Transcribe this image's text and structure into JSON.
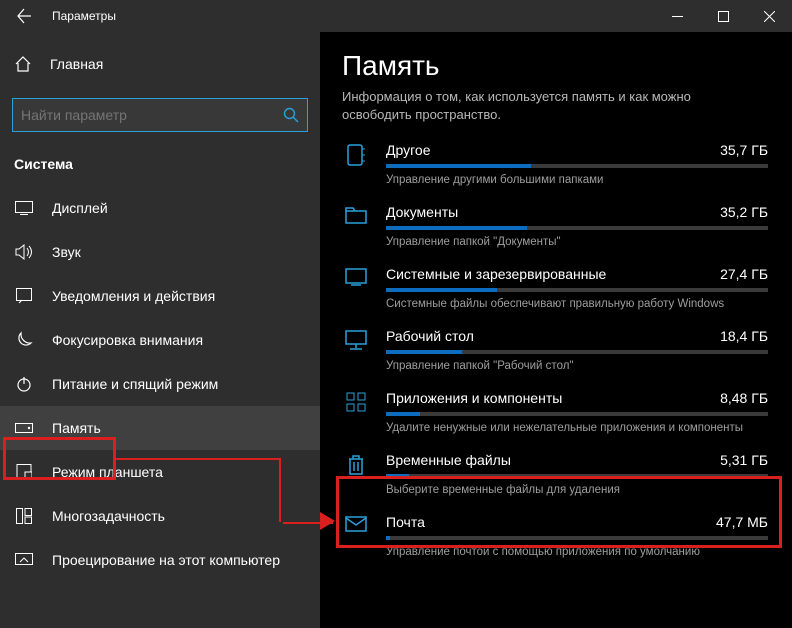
{
  "titlebar": {
    "title": "Параметры"
  },
  "sidebar": {
    "home": "Главная",
    "search_placeholder": "Найти параметр",
    "section": "Система",
    "items": [
      {
        "label": "Дисплей"
      },
      {
        "label": "Звук"
      },
      {
        "label": "Уведомления и действия"
      },
      {
        "label": "Фокусировка внимания"
      },
      {
        "label": "Питание и спящий режим"
      },
      {
        "label": "Память"
      },
      {
        "label": "Режим планшета"
      },
      {
        "label": "Многозадачность"
      },
      {
        "label": "Проецирование на этот компьютер"
      }
    ]
  },
  "main": {
    "title": "Память",
    "intro_l1": "Информация о том, как используется память и как можно",
    "intro_l2": "освободить пространство.",
    "categories": [
      {
        "name": "Другое",
        "size": "35,7 ГБ",
        "desc": "Управление другими большими папками",
        "fill": 38
      },
      {
        "name": "Документы",
        "size": "35,2 ГБ",
        "desc": "Управление папкой \"Документы\"",
        "fill": 37
      },
      {
        "name": "Системные и зарезервированные",
        "size": "27,4 ГБ",
        "desc": "Системные файлы обеспечивают правильную работу Windows",
        "fill": 29
      },
      {
        "name": "Рабочий стол",
        "size": "18,4 ГБ",
        "desc": "Управление папкой \"Рабочий стол\"",
        "fill": 20
      },
      {
        "name": "Приложения и компоненты",
        "size": "8,48 ГБ",
        "desc": "Удалите ненужные или нежелательные приложения и компоненты",
        "fill": 9
      },
      {
        "name": "Временные файлы",
        "size": "5,31 ГБ",
        "desc": "Выберите временные файлы для удаления",
        "fill": 6
      },
      {
        "name": "Почта",
        "size": "47,7 МБ",
        "desc": "Управление почтой с помощью приложения по умолчанию",
        "fill": 1
      }
    ]
  }
}
